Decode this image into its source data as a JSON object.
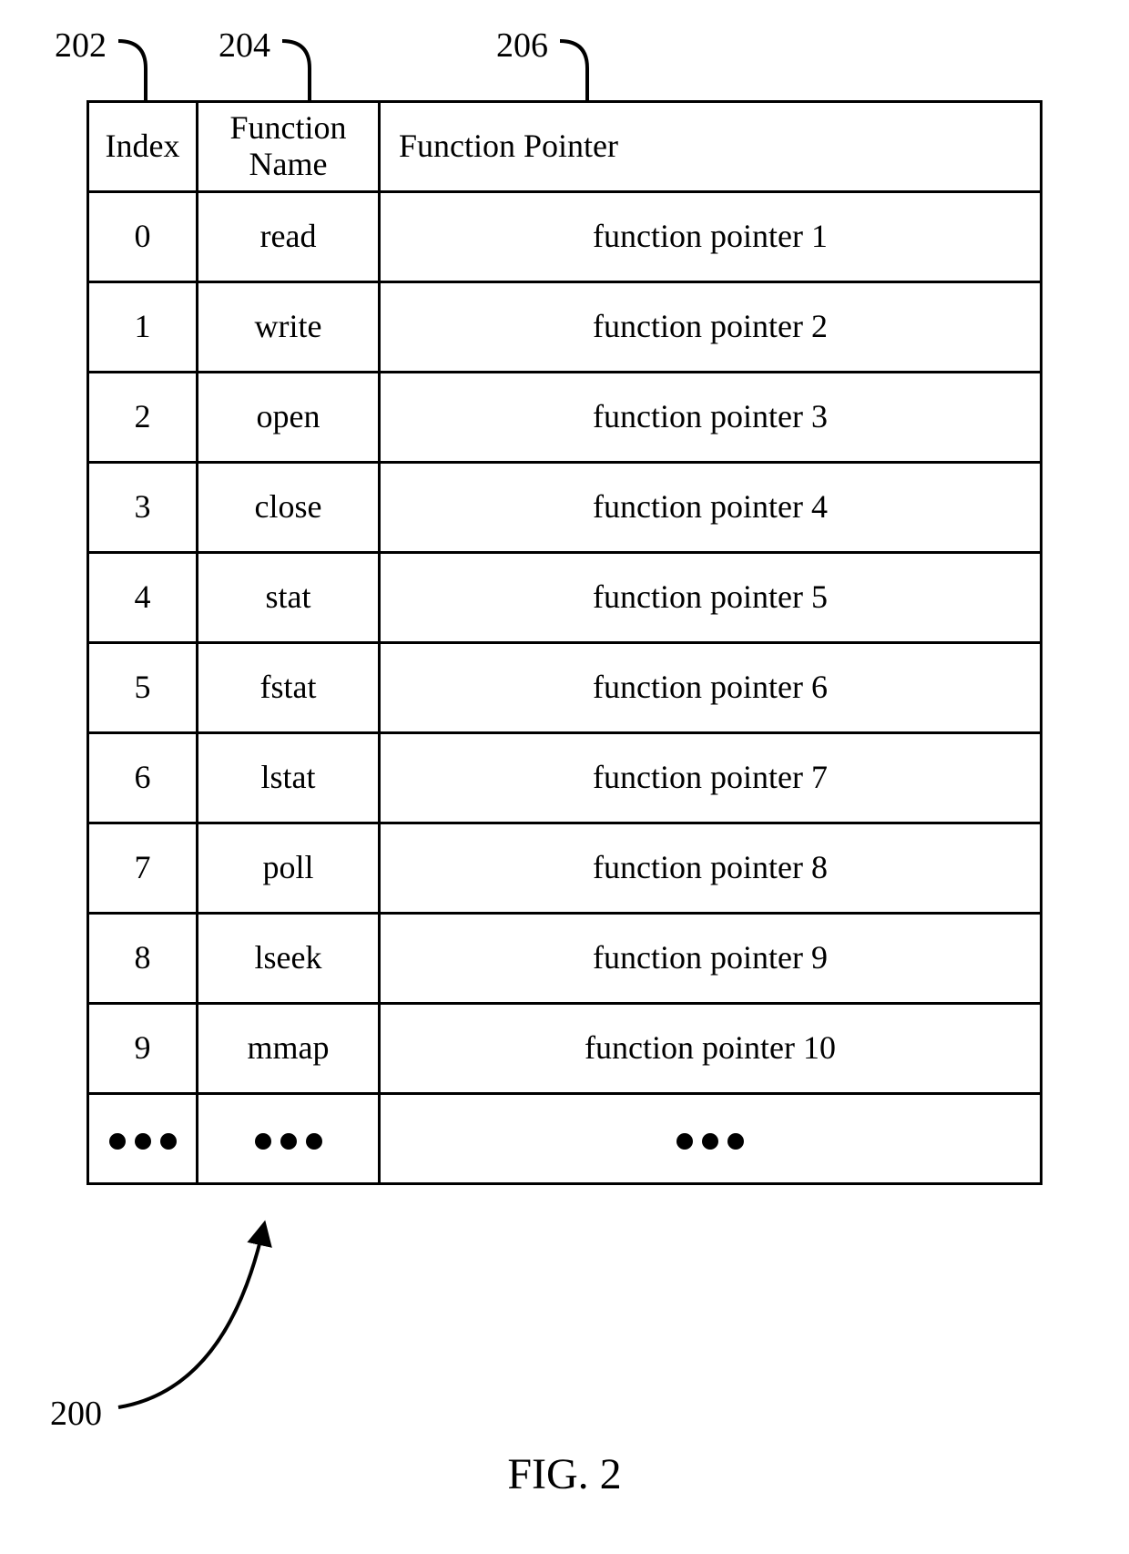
{
  "callouts": {
    "c202": "202",
    "c204": "204",
    "c206": "206",
    "c200": "200"
  },
  "headers": {
    "index": "Index",
    "name": "Function\nName",
    "pointer": "Function Pointer"
  },
  "rows": [
    {
      "idx": "0",
      "name": "read",
      "ptr": "function pointer 1"
    },
    {
      "idx": "1",
      "name": "write",
      "ptr": "function pointer 2"
    },
    {
      "idx": "2",
      "name": "open",
      "ptr": "function pointer 3"
    },
    {
      "idx": "3",
      "name": "close",
      "ptr": "function pointer 4"
    },
    {
      "idx": "4",
      "name": "stat",
      "ptr": "function pointer 5"
    },
    {
      "idx": "5",
      "name": "fstat",
      "ptr": "function pointer 6"
    },
    {
      "idx": "6",
      "name": "lstat",
      "ptr": "function pointer 7"
    },
    {
      "idx": "7",
      "name": "poll",
      "ptr": "function pointer 8"
    },
    {
      "idx": "8",
      "name": "lseek",
      "ptr": "function pointer 9"
    },
    {
      "idx": "9",
      "name": "mmap",
      "ptr": "function pointer 10"
    }
  ],
  "figure": "FIG. 2"
}
